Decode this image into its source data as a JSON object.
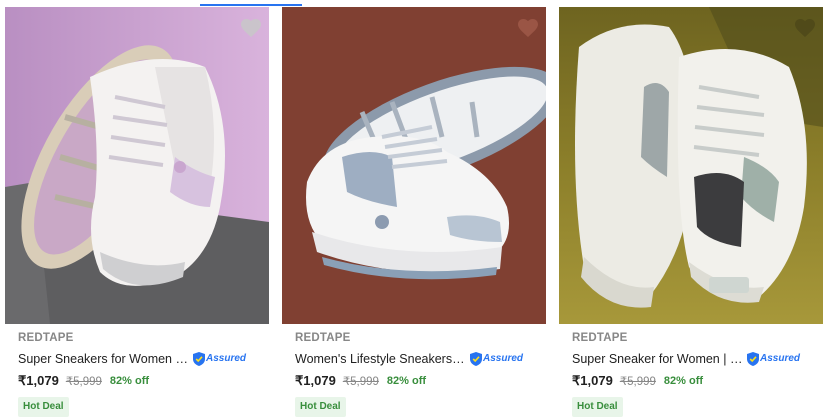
{
  "colors": {
    "accent": "#2874f0",
    "discount_green": "#388e3c",
    "deal_bg": "#e8f5e9",
    "muted": "#878787"
  },
  "products": [
    {
      "brand": "REDTAPE",
      "title": "Super Sneakers for Women | Lo...",
      "assured_label": "Assured",
      "price": "₹1,079",
      "mrp": "₹5,999",
      "discount": "82% off",
      "deal_badge": "Hot Deal",
      "wishlist_icon": "heart-icon"
    },
    {
      "brand": "REDTAPE",
      "title": "Women's Lifestyle Sneakers | Ef...",
      "assured_label": "Assured",
      "price": "₹1,079",
      "mrp": "₹5,999",
      "discount": "82% off",
      "deal_badge": "Hot Deal",
      "wishlist_icon": "heart-icon"
    },
    {
      "brand": "REDTAPE",
      "title": "Super Sneaker for Women | Low...",
      "assured_label": "Assured",
      "price": "₹1,079",
      "mrp": "₹5,999",
      "discount": "82% off",
      "deal_badge": "Hot Deal",
      "wishlist_icon": "heart-icon"
    }
  ]
}
